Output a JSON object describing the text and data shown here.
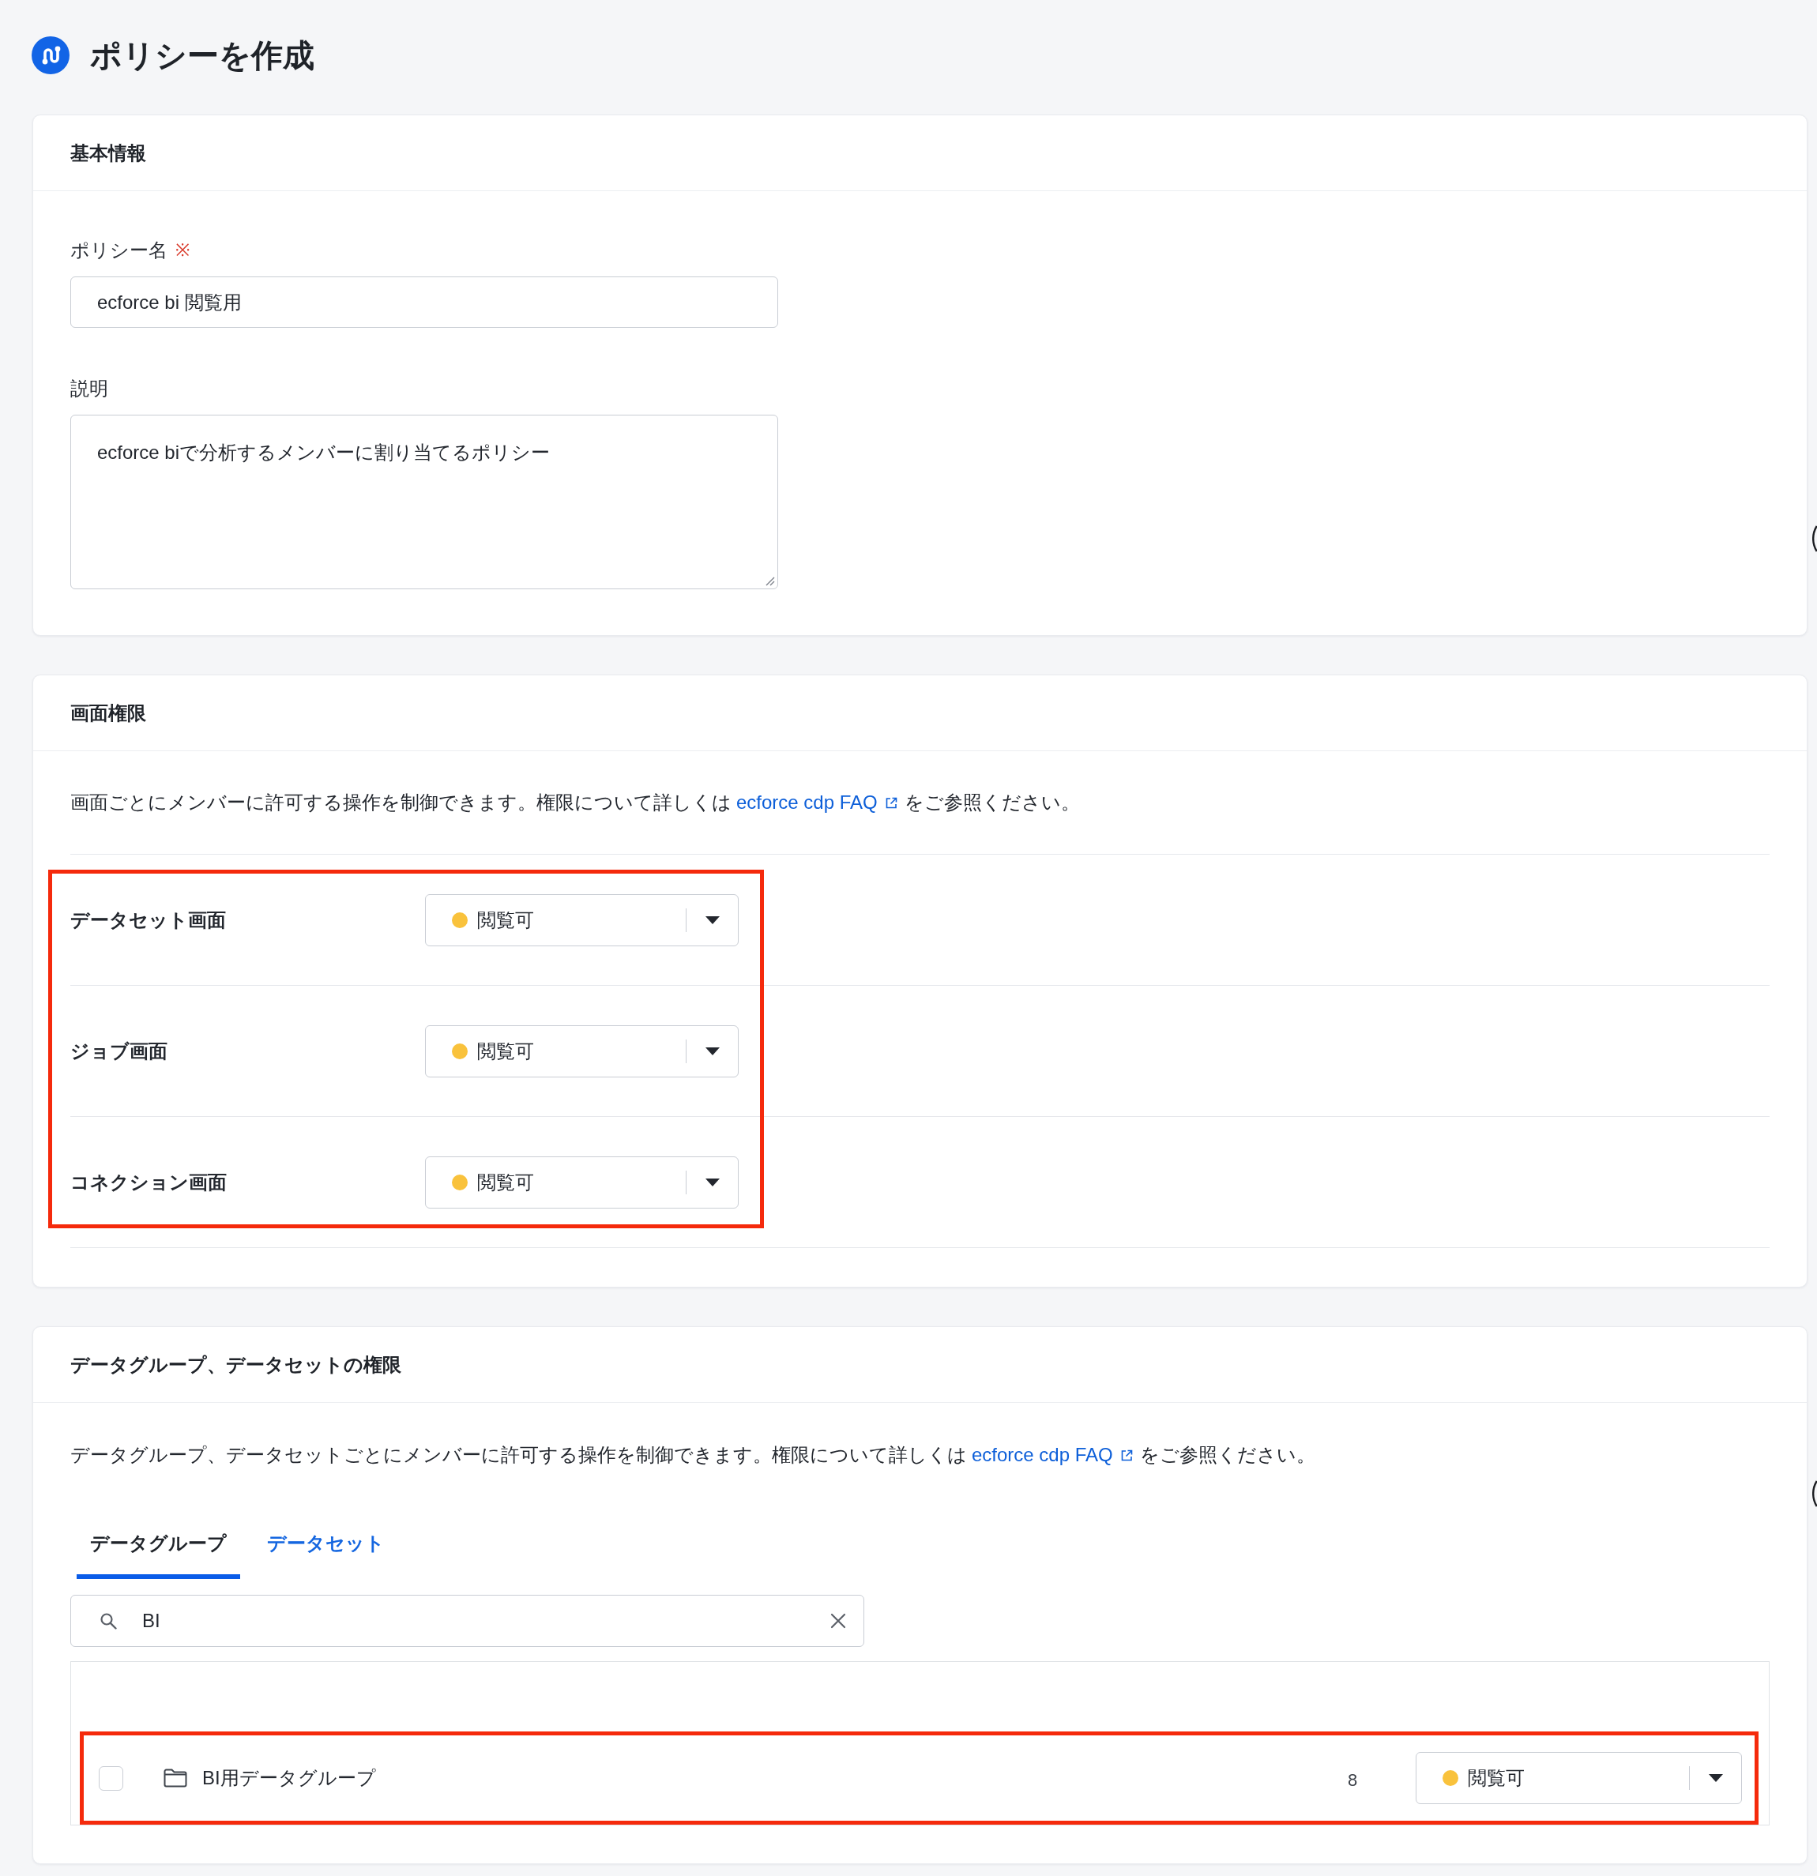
{
  "page": {
    "title": "ポリシーを作成"
  },
  "basic_info": {
    "heading": "基本情報",
    "fields": [
      {
        "kind": "input",
        "label": "ポリシー名",
        "required_mark": "※",
        "value": "ecforce bi 閲覧用"
      },
      {
        "kind": "textarea",
        "label": "説明",
        "value": "ecforce biで分析するメンバーに割り当てるポリシー"
      }
    ]
  },
  "screen_permissions": {
    "heading": "画面権限",
    "description": {
      "text": "画面ごとにメンバーに許可する操作を制御できます。権限について詳しくは",
      "link": "ecforce cdp FAQ",
      "text_after": "をご参照ください。"
    },
    "highlighted": true,
    "rows": [
      {
        "label": "データセット画面",
        "permission": "閲覧可",
        "color": "#f9c23c"
      },
      {
        "label": "ジョブ画面",
        "permission": "閲覧可",
        "color": "#f9c23c"
      },
      {
        "label": "コネクション画面",
        "permission": "閲覧可",
        "color": "#f9c23c"
      }
    ]
  },
  "data_permissions": {
    "heading": "データグループ、データセットの権限",
    "description": {
      "text": "データグループ、データセットごとにメンバーに許可する操作を制御できます。権限について詳しくは",
      "link": "ecforce cdp FAQ",
      "text_after": "をご参照ください。"
    },
    "tabs": [
      {
        "label": "データグループ",
        "selected": true
      },
      {
        "label": "データセット",
        "selected": false
      }
    ],
    "search": {
      "value": "BI"
    },
    "rows": [
      {
        "checked": false,
        "name": "BI用データグループ",
        "column_3": "8",
        "permission": "閲覧可",
        "color": "#f9c23c",
        "highlighted": true
      }
    ]
  }
}
